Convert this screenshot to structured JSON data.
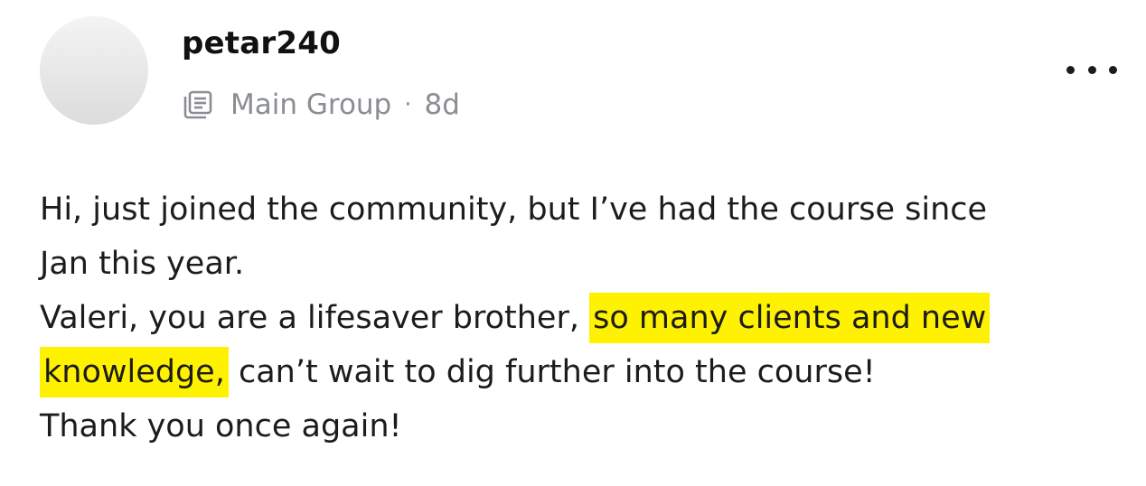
{
  "post": {
    "username": "petar240",
    "group_icon": "group-icon",
    "group_name": "Main Group",
    "separator": "·",
    "age": "8d",
    "more_icon": "ellipsis-icon",
    "highlight_color": "#fff200",
    "lines": {
      "l1": "Hi, just joined the community, but I’ve had the course since",
      "l2": "Jan this year.",
      "l3a": "Valeri, you are a lifesaver brother,",
      "l3b": "so many clients and new",
      "l4a": "knowledge,",
      "l4b": "can’t wait to dig further into the course!",
      "l5": "Thank you once again!"
    }
  }
}
